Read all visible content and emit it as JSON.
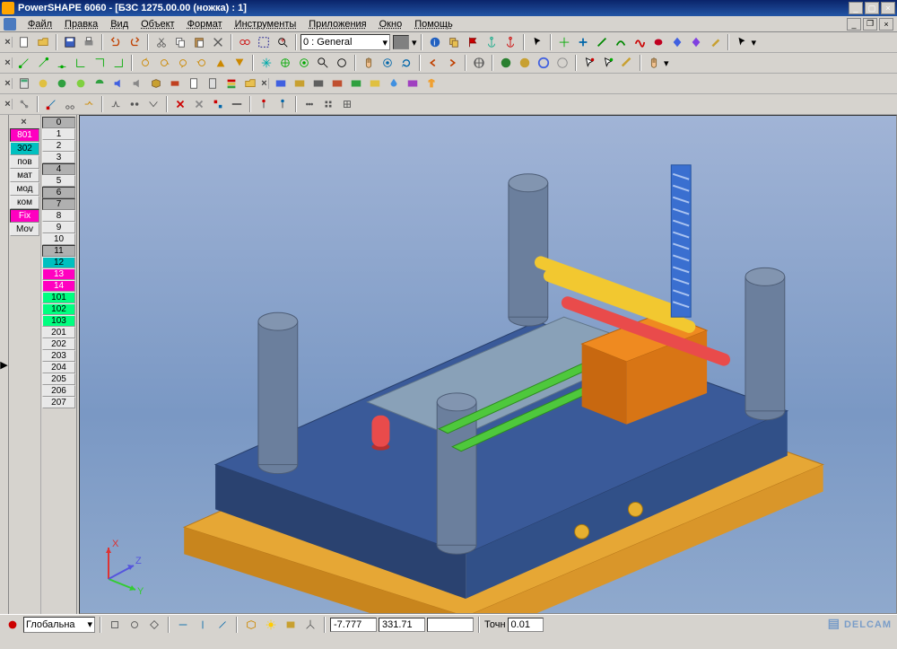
{
  "titlebar": {
    "title": "PowerSHAPE 6060 - [БЗС 1275.00.00 (ножка) : 1]"
  },
  "menu": {
    "items": [
      "Файл",
      "Правка",
      "Вид",
      "Объект",
      "Формат",
      "Инструменты",
      "Приложения",
      "Окно",
      "Помощь"
    ]
  },
  "toolbar1": {
    "layer_dropdown": "0 : General"
  },
  "left_layers1": {
    "items": [
      {
        "label": "801",
        "cls": "active"
      },
      {
        "label": "302",
        "cls": "teal"
      },
      {
        "label": "пов",
        "cls": ""
      },
      {
        "label": "мат",
        "cls": ""
      },
      {
        "label": "мод",
        "cls": ""
      },
      {
        "label": "ком",
        "cls": ""
      },
      {
        "label": "Fix",
        "cls": "active"
      },
      {
        "label": "Mov",
        "cls": ""
      }
    ]
  },
  "left_levels": [
    {
      "label": "0",
      "cls": "sel"
    },
    {
      "label": "1",
      "cls": ""
    },
    {
      "label": "2",
      "cls": ""
    },
    {
      "label": "3",
      "cls": ""
    },
    {
      "label": "4",
      "cls": "sel"
    },
    {
      "label": "5",
      "cls": ""
    },
    {
      "label": "6",
      "cls": "sel"
    },
    {
      "label": "7",
      "cls": "sel"
    },
    {
      "label": "8",
      "cls": ""
    },
    {
      "label": "9",
      "cls": ""
    },
    {
      "label": "10",
      "cls": ""
    },
    {
      "label": "11",
      "cls": "sel"
    },
    {
      "label": "12",
      "cls": "teal"
    },
    {
      "label": "13",
      "cls": "pink"
    },
    {
      "label": "14",
      "cls": "pink"
    },
    {
      "label": "101",
      "cls": "grn"
    },
    {
      "label": "102",
      "cls": "grn"
    },
    {
      "label": "103",
      "cls": "grn"
    },
    {
      "label": "201",
      "cls": ""
    },
    {
      "label": "202",
      "cls": ""
    },
    {
      "label": "203",
      "cls": ""
    },
    {
      "label": "204",
      "cls": ""
    },
    {
      "label": "205",
      "cls": ""
    },
    {
      "label": "206",
      "cls": ""
    },
    {
      "label": "207",
      "cls": ""
    }
  ],
  "status": {
    "coord_sys": "Глобальна",
    "x": "-7.777",
    "y": "331.71",
    "z": "",
    "tol_label": "Точн",
    "tol": "0.01"
  },
  "triad": {
    "x": "X",
    "y": "Y",
    "z": "Z"
  },
  "watermark": "DELCAM"
}
